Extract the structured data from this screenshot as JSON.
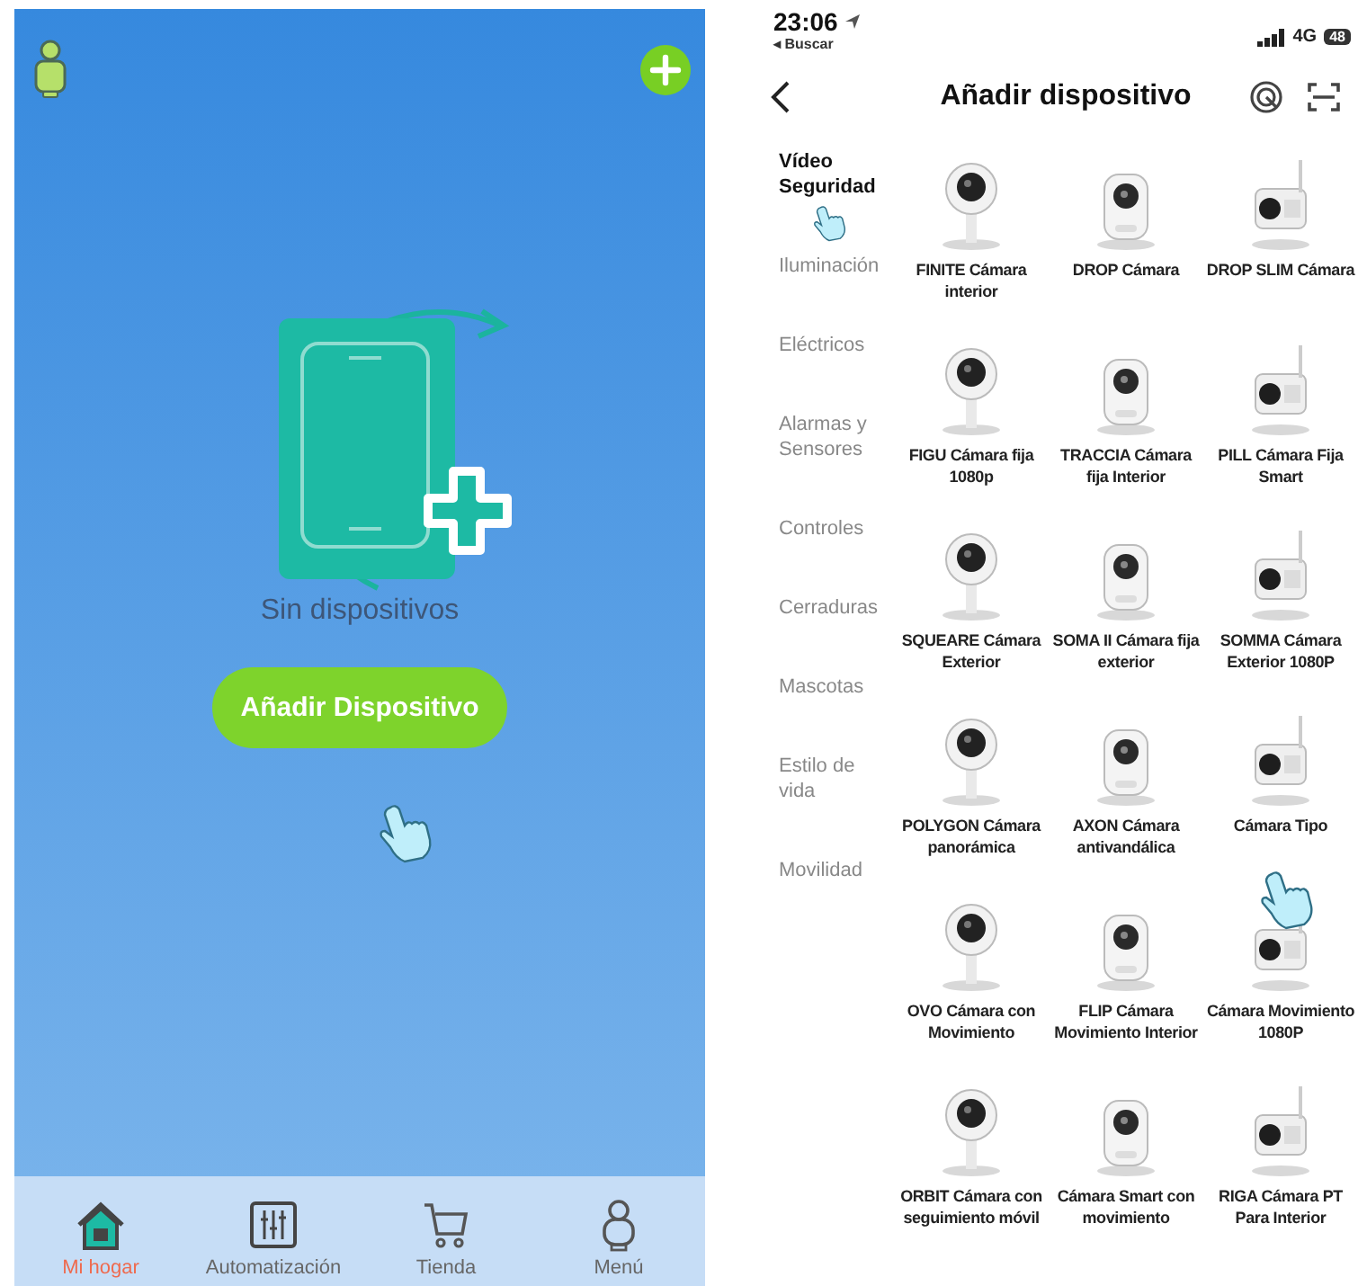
{
  "home_screen": {
    "empty_message": "Sin dispositivos",
    "add_device_button": "Añadir Dispositivo",
    "tabs": [
      {
        "label": "Mi hogar",
        "selected": true,
        "kind": "home"
      },
      {
        "label": "Automatización",
        "selected": false,
        "kind": "automation"
      },
      {
        "label": "Tienda",
        "selected": false,
        "kind": "cart"
      },
      {
        "label": "Menú",
        "selected": false,
        "kind": "person"
      }
    ]
  },
  "add_device_screen": {
    "status_bar": {
      "time": "23:06",
      "back_app": "◂ Buscar",
      "network": "4G",
      "battery": "48"
    },
    "title": "Añadir dispositivo",
    "categories": [
      {
        "label": "Vídeo Seguridad",
        "selected": true
      },
      {
        "label": "Iluminación",
        "selected": false
      },
      {
        "label": "Eléctricos",
        "selected": false
      },
      {
        "label": "Alarmas y Sensores",
        "selected": false
      },
      {
        "label": "Controles",
        "selected": false
      },
      {
        "label": "Cerraduras",
        "selected": false
      },
      {
        "label": "Mascotas",
        "selected": false
      },
      {
        "label": "Estilo de vida",
        "selected": false
      },
      {
        "label": "Movilidad",
        "selected": false
      }
    ],
    "products": [
      {
        "name": "FINITE Cámara interior"
      },
      {
        "name": "DROP Cámara"
      },
      {
        "name": "DROP SLIM Cámara"
      },
      {
        "name": "FIGU Cámara fija 1080p"
      },
      {
        "name": "TRACCIA Cámara fija Interior"
      },
      {
        "name": "PILL Cámara Fija Smart"
      },
      {
        "name": "SQUEARE Cámara Exterior"
      },
      {
        "name": "SOMA II Cámara fija exterior"
      },
      {
        "name": "SOMMA Cámara Exterior 1080P"
      },
      {
        "name": "POLYGON Cámara panorámica"
      },
      {
        "name": "AXON Cámara antivandálica"
      },
      {
        "name": "Cámara Tipo"
      },
      {
        "name": "OVO Cámara con Movimiento"
      },
      {
        "name": "FLIP Cámara Movimiento Interior"
      },
      {
        "name": "Cámara Movimiento 1080P"
      },
      {
        "name": "ORBIT Cámara con seguimiento móvil"
      },
      {
        "name": "Cámara Smart con movimiento"
      },
      {
        "name": "RIGA Cámara PT Para Interior"
      }
    ]
  }
}
